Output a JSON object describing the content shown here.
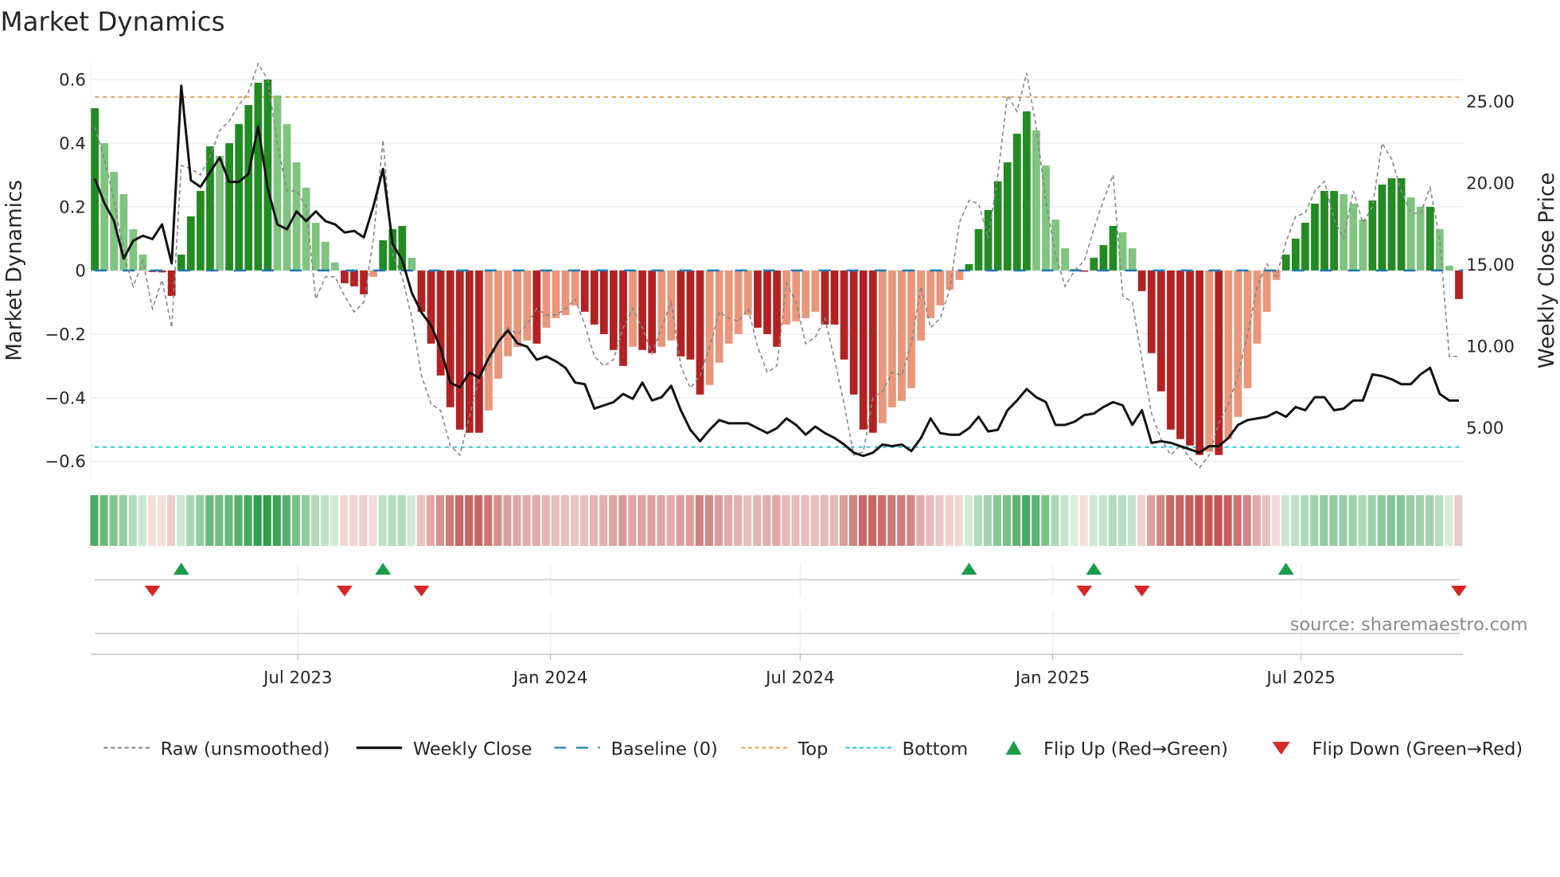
{
  "chart_data": {
    "type": "bar",
    "title": "Market Dynamics",
    "ylabel": "Market Dynamics",
    "y2label": "Weekly Close Price",
    "ylim": [
      -0.65,
      0.65
    ],
    "yticks": [
      "0.6",
      "0.4",
      "0.2",
      "0",
      "−0.2",
      "−0.4",
      "−0.6"
    ],
    "ytick_values": [
      0.6,
      0.4,
      0.2,
      0,
      -0.2,
      -0.4,
      -0.6
    ],
    "y2ticks": [
      "25.00",
      "20.00",
      "15.00",
      "10.00",
      "5.00"
    ],
    "y2tick_values": [
      25,
      20,
      15,
      10,
      5
    ],
    "xticks": [
      "Jul 2023",
      "Jan 2024",
      "Jul 2024",
      "Jan 2025",
      "Jul 2025"
    ],
    "xtick_dates": [
      "2023-07-01",
      "2024-01-01",
      "2024-07-01",
      "2025-01-01",
      "2025-07-01"
    ],
    "start_date": "2023-02-03",
    "frequency": "weekly",
    "top_level": 0.545,
    "bottom_level": -0.555,
    "baseline": 0,
    "dynamics": [
      0.51,
      0.4,
      0.31,
      0.24,
      0.13,
      0.05,
      -0.005,
      -0.006,
      -0.08,
      0.05,
      0.17,
      0.25,
      0.39,
      0.36,
      0.4,
      0.46,
      0.52,
      0.59,
      0.6,
      0.55,
      0.46,
      0.34,
      0.26,
      0.15,
      0.09,
      0.025,
      -0.04,
      -0.05,
      -0.075,
      -0.02,
      0.095,
      0.13,
      0.14,
      0.04,
      -0.13,
      -0.23,
      -0.33,
      -0.43,
      -0.5,
      -0.51,
      -0.51,
      -0.44,
      -0.34,
      -0.27,
      -0.24,
      -0.22,
      -0.23,
      -0.18,
      -0.15,
      -0.14,
      -0.11,
      -0.13,
      -0.17,
      -0.2,
      -0.25,
      -0.3,
      -0.24,
      -0.25,
      -0.26,
      -0.24,
      -0.22,
      -0.27,
      -0.28,
      -0.39,
      -0.36,
      -0.29,
      -0.23,
      -0.2,
      -0.14,
      -0.18,
      -0.2,
      -0.24,
      -0.17,
      -0.16,
      -0.15,
      -0.13,
      -0.17,
      -0.17,
      -0.28,
      -0.39,
      -0.5,
      -0.51,
      -0.48,
      -0.43,
      -0.41,
      -0.37,
      -0.22,
      -0.15,
      -0.11,
      -0.06,
      -0.03,
      0.02,
      0.13,
      0.19,
      0.28,
      0.34,
      0.43,
      0.5,
      0.44,
      0.33,
      0.16,
      0.07,
      0.005,
      -0.004,
      0.04,
      0.08,
      0.14,
      0.12,
      0.07,
      -0.065,
      -0.26,
      -0.38,
      -0.5,
      -0.53,
      -0.55,
      -0.58,
      -0.57,
      -0.58,
      -0.53,
      -0.46,
      -0.37,
      -0.23,
      -0.13,
      -0.03,
      0.05,
      0.1,
      0.15,
      0.21,
      0.25,
      0.25,
      0.24,
      0.21,
      0.16,
      0.22,
      0.27,
      0.29,
      0.29,
      0.23,
      0.2,
      0.2,
      0.13,
      0.015,
      -0.09
    ],
    "raw": [
      0.45,
      0.35,
      0.22,
      0.05,
      -0.05,
      0.03,
      -0.12,
      -0.03,
      -0.18,
      0.33,
      0.32,
      0.3,
      0.36,
      0.44,
      0.47,
      0.52,
      0.56,
      0.65,
      0.6,
      0.4,
      0.25,
      0.25,
      0.2,
      -0.09,
      -0.02,
      -0.02,
      -0.08,
      -0.13,
      -0.1,
      0.1,
      0.41,
      0.05,
      -0.02,
      -0.15,
      -0.33,
      -0.42,
      -0.44,
      -0.55,
      -0.58,
      -0.46,
      -0.34,
      -0.3,
      -0.22,
      -0.18,
      -0.2,
      -0.17,
      -0.12,
      -0.14,
      -0.14,
      -0.12,
      -0.09,
      -0.17,
      -0.27,
      -0.3,
      -0.28,
      -0.18,
      -0.12,
      -0.18,
      -0.26,
      -0.18,
      -0.1,
      -0.3,
      -0.37,
      -0.33,
      -0.24,
      -0.13,
      -0.15,
      -0.16,
      -0.12,
      -0.24,
      -0.32,
      -0.3,
      -0.04,
      -0.1,
      -0.23,
      -0.21,
      -0.15,
      -0.28,
      -0.42,
      -0.58,
      -0.57,
      -0.4,
      -0.38,
      -0.32,
      -0.33,
      -0.23,
      -0.05,
      -0.18,
      -0.15,
      -0.06,
      0.15,
      0.22,
      0.21,
      0.1,
      0.3,
      0.55,
      0.5,
      0.62,
      0.45,
      0.22,
      0.05,
      -0.05,
      0.0,
      0.03,
      0.13,
      0.22,
      0.3,
      -0.08,
      -0.1,
      -0.28,
      -0.45,
      -0.53,
      -0.58,
      -0.55,
      -0.59,
      -0.62,
      -0.58,
      -0.48,
      -0.42,
      -0.33,
      -0.2,
      -0.05,
      0.02,
      -0.02,
      0.09,
      0.17,
      0.18,
      0.25,
      0.28,
      0.16,
      0.1,
      0.25,
      0.15,
      0.2,
      0.4,
      0.35,
      0.25,
      0.18,
      0.18,
      0.26,
      0.1,
      -0.27,
      -0.27
    ],
    "weekly_close": [
      20.2,
      18.7,
      17.6,
      15.3,
      16.4,
      16.7,
      16.5,
      17.4,
      15.0,
      25.9,
      20.1,
      19.7,
      20.6,
      21.5,
      20.0,
      20.0,
      20.5,
      23.4,
      19.6,
      17.4,
      17.1,
      18.2,
      17.6,
      18.2,
      17.6,
      17.4,
      16.9,
      17.0,
      16.6,
      18.5,
      20.8,
      16.2,
      15.2,
      13.2,
      12.0,
      11.2,
      9.8,
      7.7,
      7.4,
      8.3,
      8.0,
      9.2,
      10.2,
      10.9,
      10.1,
      9.9,
      9.1,
      9.3,
      9.0,
      8.6,
      7.7,
      7.6,
      6.1,
      6.3,
      6.5,
      7.0,
      6.7,
      7.7,
      6.6,
      6.8,
      7.5,
      6.0,
      4.8,
      4.1,
      4.8,
      5.4,
      5.2,
      5.2,
      5.2,
      4.9,
      4.6,
      4.9,
      5.5,
      5.1,
      4.5,
      5.0,
      4.6,
      4.3,
      3.9,
      3.4,
      3.2,
      3.4,
      3.9,
      3.8,
      3.9,
      3.5,
      4.3,
      5.5,
      4.6,
      4.5,
      4.5,
      4.9,
      5.6,
      4.7,
      4.8,
      6.0,
      6.6,
      7.3,
      6.8,
      6.5,
      5.1,
      5.1,
      5.3,
      5.7,
      5.8,
      6.2,
      6.5,
      6.3,
      5.1,
      6.0,
      4.0,
      4.1,
      4.0,
      3.8,
      3.6,
      3.4,
      3.8,
      3.8,
      4.3,
      5.1,
      5.4,
      5.5,
      5.6,
      5.9,
      5.6,
      6.2,
      6.0,
      6.8,
      6.8,
      6.0,
      6.1,
      6.6,
      6.6,
      8.2,
      8.1,
      7.9,
      7.6,
      7.6,
      8.2,
      8.6,
      7.0,
      6.6,
      6.6
    ],
    "flip_up_weeks": [
      9,
      30,
      91,
      104,
      124
    ],
    "flip_down_weeks": [
      6,
      26,
      34,
      103,
      109,
      142
    ],
    "legend": [
      {
        "label": "Raw (unsmoothed)",
        "kind": "line-dashed",
        "color": "#888888"
      },
      {
        "label": "Weekly Close",
        "kind": "line",
        "color": "#111111"
      },
      {
        "label": "Baseline (0)",
        "kind": "line-dash-long",
        "color": "#1f77b4"
      },
      {
        "label": "Top",
        "kind": "line-dotted",
        "color": "#f0a050"
      },
      {
        "label": "Bottom",
        "kind": "line-dotted",
        "color": "#2ec7dc"
      },
      {
        "label": "Flip Up (Red→Green)",
        "kind": "triangle-up",
        "color": "#1a9c48"
      },
      {
        "label": "Flip Down (Green→Red)",
        "kind": "triangle-down",
        "color": "#d62728"
      }
    ],
    "legend_position": "bottom",
    "colors": {
      "green_strong": "#228b22",
      "green_weak": "#7fc47f",
      "red_strong": "#b22222",
      "red_weak": "#e9967a",
      "heat_green": "#2e9e4a",
      "heat_red": "#c0504d"
    }
  },
  "source": "source: sharemaestro.com"
}
